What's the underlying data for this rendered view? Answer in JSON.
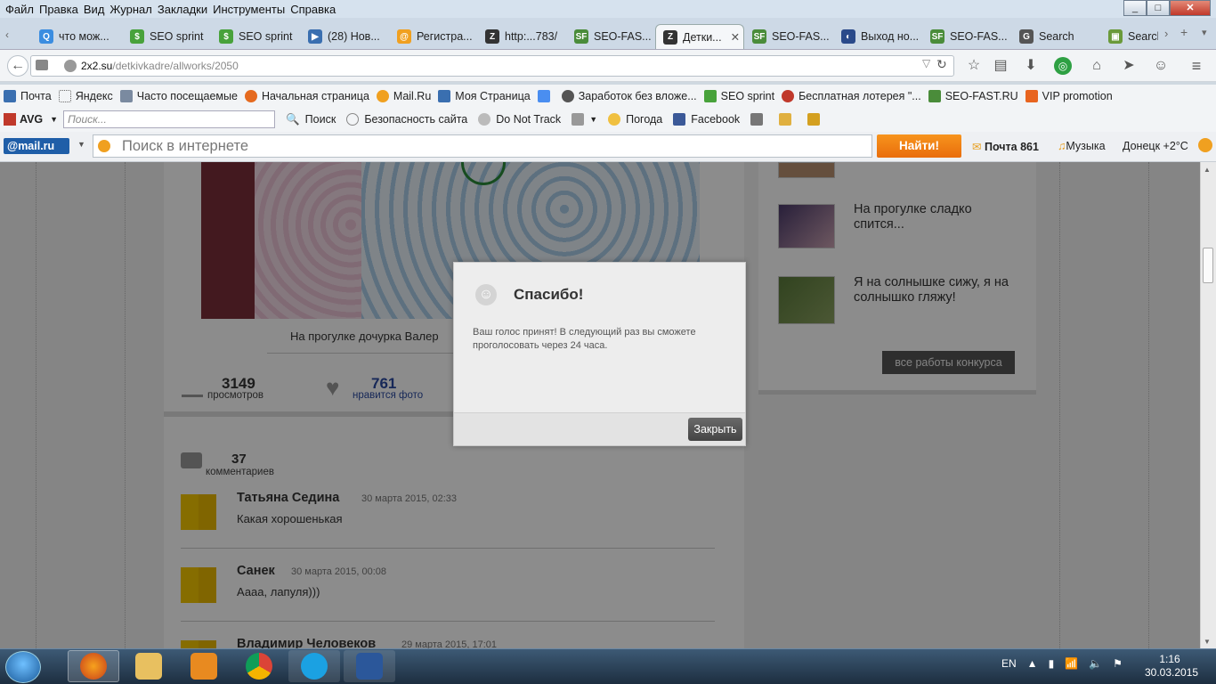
{
  "menubar": {
    "items": [
      "Файл",
      "Правка",
      "Вид",
      "Журнал",
      "Закладки",
      "Инструменты",
      "Справка"
    ]
  },
  "window_controls": {
    "minimize": "_",
    "maximize": "□",
    "close": "✕"
  },
  "tabs": [
    {
      "label": "что мож...",
      "icon": "search-icon",
      "color": "#3b8de0"
    },
    {
      "label": "SEO sprint",
      "icon": "seosprint-icon",
      "color": "#48a23b"
    },
    {
      "label": "SEO sprint",
      "icon": "seosprint-icon",
      "color": "#48a23b"
    },
    {
      "label": "(28) Нов...",
      "icon": "video-icon",
      "color": "#3a6fb0"
    },
    {
      "label": "Регистра...",
      "icon": "spiral-icon",
      "color": "#f0a020"
    },
    {
      "label": "http:...783/",
      "icon": "z-icon",
      "color": "#333333"
    },
    {
      "label": "SEO-FAS...",
      "icon": "sf-icon",
      "color": "#4a8c3a"
    },
    {
      "label": "Детки...",
      "icon": "z-icon",
      "color": "#333333"
    },
    {
      "label": "SEO-FAS...",
      "icon": "sf-icon",
      "color": "#4a8c3a"
    },
    {
      "label": "Выход но...",
      "icon": "moon-icon",
      "color": "#2a4a8a"
    },
    {
      "label": "SEO-FAS...",
      "icon": "sf-icon",
      "color": "#4a8c3a"
    },
    {
      "label": "Search",
      "icon": "g-icon",
      "color": "#555555"
    },
    {
      "label": "Search",
      "icon": "picture-icon",
      "color": "#6a9a3a"
    }
  ],
  "active_tab_close": "✕",
  "address": {
    "host": "2x2.su",
    "path": "/detkivkadre/allworks/2050"
  },
  "bookmarks": [
    "Почта",
    "Яндекс",
    "Часто посещаемые",
    "Начальная страница",
    "Mail.Ru",
    "Моя Страница",
    "Заработок без вложе...",
    "SEO sprint",
    "Бесплатная лотерея \"...",
    "SEO-FAST.RU",
    "VIP promotion"
  ],
  "avg": {
    "label": "AVG",
    "search_placeholder": "Поиск...",
    "search_btn": "Поиск",
    "site_safety": "Безопасность сайта",
    "dnt": "Do Not Track",
    "weather": "Погода",
    "facebook": "Facebook"
  },
  "mailru": {
    "logo": "@mail.ru",
    "search_placeholder": "Поиск в интернете",
    "find_btn": "Найти!",
    "mail": "Почта 861",
    "music": "Музыка",
    "weather": "Донецк +2°C"
  },
  "photo": {
    "caption": "На прогулке дочурка Валер"
  },
  "stats": {
    "views": "3149",
    "views_label": "просмотров",
    "likes": "761",
    "likes_label": "нравится фото"
  },
  "comments": {
    "count": "37",
    "count_label": "комментариев",
    "items": [
      {
        "name": "Татьяна Седина",
        "date": "30 марта 2015, 02:33",
        "text": "Какая хорошенькая"
      },
      {
        "name": "Санек",
        "date": "30 марта 2015, 00:08",
        "text": "Аааа, лапуля)))"
      },
      {
        "name": "Владимир Человеков",
        "date": "29 марта 2015, 17:01",
        "text": ""
      }
    ]
  },
  "sidebar": {
    "works": [
      {
        "title": "На прогулке сладко спится..."
      },
      {
        "title": "Я на солнышке сижу, я на солнышко гляжу!"
      }
    ],
    "all_works_btn": "все работы конкурса"
  },
  "dialog": {
    "title": "Спасибо!",
    "text": "Ваш голос принят! В следующий раз вы сможете проголосовать через 24 часа.",
    "close_btn": "Закрыть"
  },
  "taskbar": {
    "lang": "EN",
    "time": "1:16",
    "date": "30.03.2015"
  }
}
